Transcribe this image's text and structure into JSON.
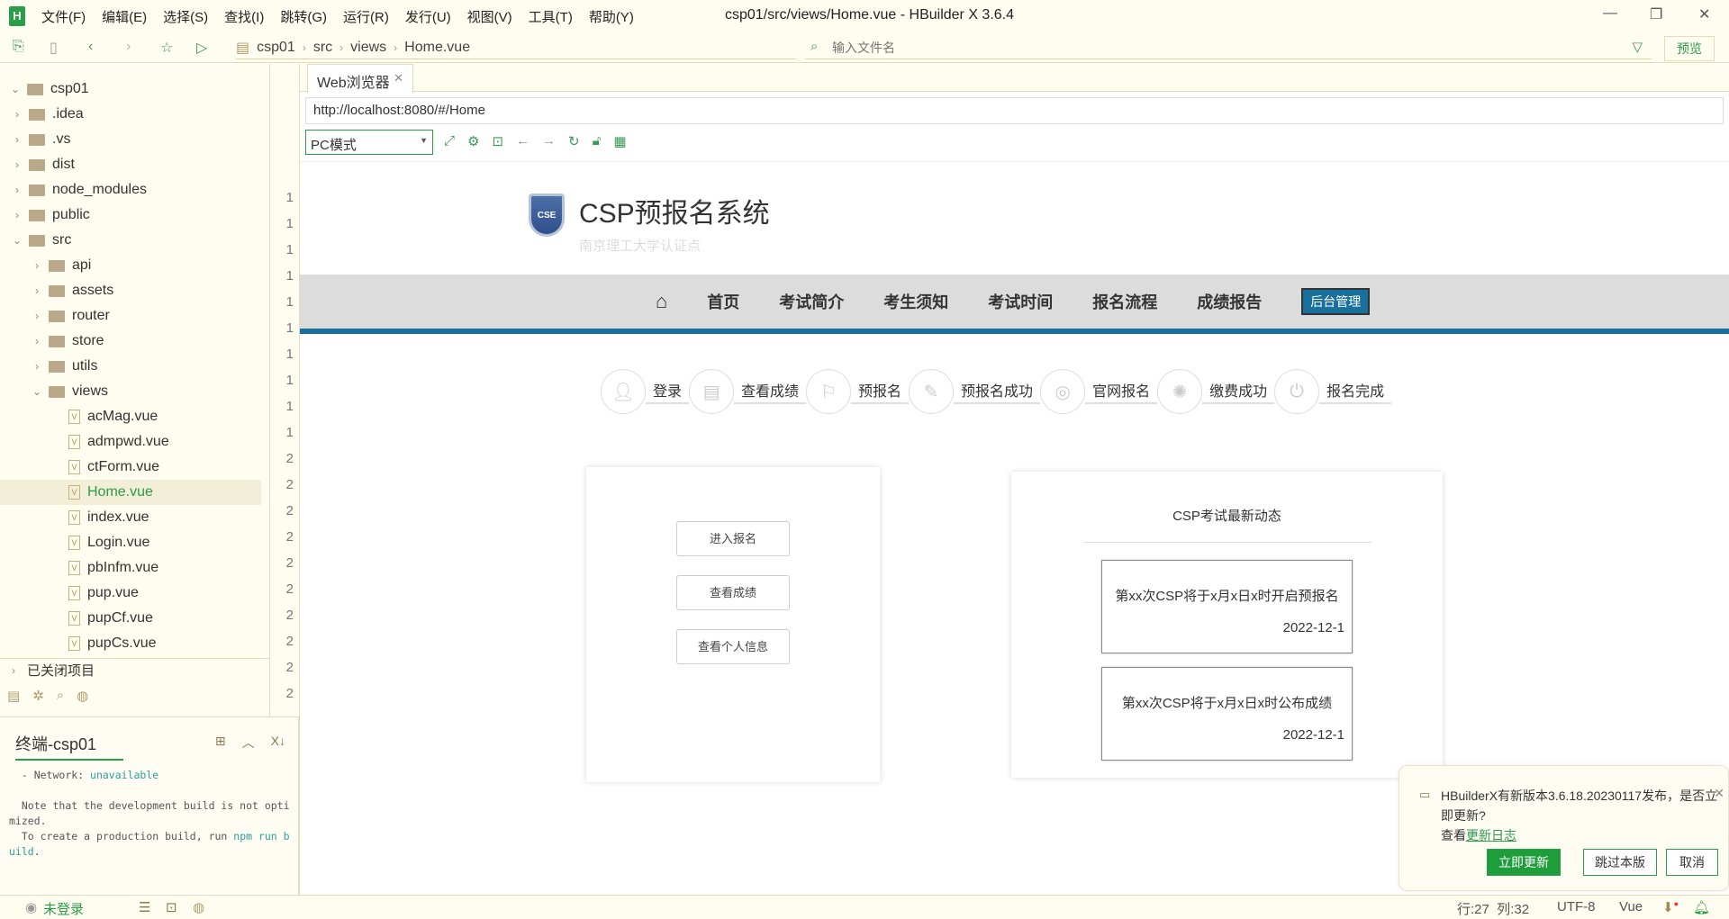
{
  "app": {
    "logo": "H",
    "menus": [
      "文件(F)",
      "编辑(E)",
      "选择(S)",
      "查找(I)",
      "跳转(G)",
      "运行(R)",
      "发行(U)",
      "视图(V)",
      "工具(T)",
      "帮助(Y)"
    ],
    "title": "csp01/src/views/Home.vue - HBuilder X 3.6.4"
  },
  "toolbar": {
    "breadcrumb": [
      "csp01",
      "src",
      "views",
      "Home.vue"
    ],
    "file_search_placeholder": "输入文件名",
    "preview_label": "预览"
  },
  "sidebar": {
    "tree": [
      {
        "label": "csp01",
        "type": "project",
        "depth": 0,
        "expanded": true
      },
      {
        "label": ".idea",
        "type": "folder",
        "depth": 1
      },
      {
        "label": ".vs",
        "type": "folder",
        "depth": 1
      },
      {
        "label": "dist",
        "type": "folder",
        "depth": 1
      },
      {
        "label": "node_modules",
        "type": "folder",
        "depth": 1
      },
      {
        "label": "public",
        "type": "folder",
        "depth": 1
      },
      {
        "label": "src",
        "type": "folder",
        "depth": 1,
        "expanded": true
      },
      {
        "label": "api",
        "type": "folder",
        "depth": 2
      },
      {
        "label": "assets",
        "type": "folder",
        "depth": 2
      },
      {
        "label": "router",
        "type": "folder",
        "depth": 2
      },
      {
        "label": "store",
        "type": "folder",
        "depth": 2
      },
      {
        "label": "utils",
        "type": "folder",
        "depth": 2
      },
      {
        "label": "views",
        "type": "folder",
        "depth": 2,
        "expanded": true
      },
      {
        "label": "acMag.vue",
        "type": "file",
        "depth": 3
      },
      {
        "label": "admpwd.vue",
        "type": "file",
        "depth": 3
      },
      {
        "label": "ctForm.vue",
        "type": "file",
        "depth": 3
      },
      {
        "label": "Home.vue",
        "type": "file",
        "depth": 3,
        "selected": true
      },
      {
        "label": "index.vue",
        "type": "file",
        "depth": 3
      },
      {
        "label": "Login.vue",
        "type": "file",
        "depth": 3
      },
      {
        "label": "pbInfm.vue",
        "type": "file",
        "depth": 3
      },
      {
        "label": "pup.vue",
        "type": "file",
        "depth": 3
      },
      {
        "label": "pupCf.vue",
        "type": "file",
        "depth": 3
      },
      {
        "label": "pupCs.vue",
        "type": "file",
        "depth": 3
      }
    ],
    "closed_projects": "已关闭项目"
  },
  "gutter": {
    "line_numbers": [
      "1",
      "1",
      "1",
      "1",
      "1",
      "1",
      "1",
      "1",
      "1",
      "1",
      "2",
      "2",
      "2",
      "2",
      "2",
      "2",
      "2",
      "2",
      "2",
      "2"
    ]
  },
  "terminal": {
    "tab": "终端-csp01",
    "lines": [
      {
        "text": "  - Network: ",
        "accent": "unavailable"
      },
      {
        "text": ""
      },
      {
        "text": "  Note that the development build is not optimized."
      },
      {
        "text": "  To create a production build, run ",
        "accent": "npm run build",
        "tail": "."
      }
    ]
  },
  "browser": {
    "tab": "Web浏览器",
    "url": "http://localhost:8080/#/Home",
    "mode": "PC模式"
  },
  "site": {
    "title": "CSP预报名系统",
    "subtitle": "南京理工大学认证点",
    "logo_text": "CSE",
    "nav": [
      "首页",
      "考试简介",
      "考生须知",
      "考试时间",
      "报名流程",
      "成绩报告"
    ],
    "admin": "后台管理",
    "steps": [
      {
        "label": "登录",
        "icon": "user-icon"
      },
      {
        "label": "查看成绩",
        "icon": "document-icon"
      },
      {
        "label": "预报名",
        "icon": "bookmark-icon"
      },
      {
        "label": "预报名成功",
        "icon": "edit-icon"
      },
      {
        "label": "官网报名",
        "icon": "lifebuoy-icon"
      },
      {
        "label": "缴费成功",
        "icon": "aperture-icon"
      },
      {
        "label": "报名完成",
        "icon": "power-icon"
      }
    ],
    "actions": [
      "进入报名",
      "查看成绩",
      "查看个人信息"
    ],
    "news_title": "CSP考试最新动态",
    "news": [
      {
        "title": "第xx次CSP将于x月x日x时开启预报名",
        "date": "2022-12-1"
      },
      {
        "title": "第xx次CSP将于x月x日x时公布成绩",
        "date": "2022-12-1"
      }
    ]
  },
  "notification": {
    "message": "HBuilderX有新版本3.6.18.20230117发布，是否立即更新?",
    "view_prefix": "查看",
    "link": "更新日志",
    "update": "立即更新",
    "skip": "跳过本版",
    "cancel": "取消"
  },
  "status": {
    "login": "未登录",
    "position": "行:27  列:32",
    "encoding": "UTF-8",
    "language": "Vue"
  },
  "colors": {
    "accent": "#2a9d48",
    "nav_blue": "#17719c"
  }
}
